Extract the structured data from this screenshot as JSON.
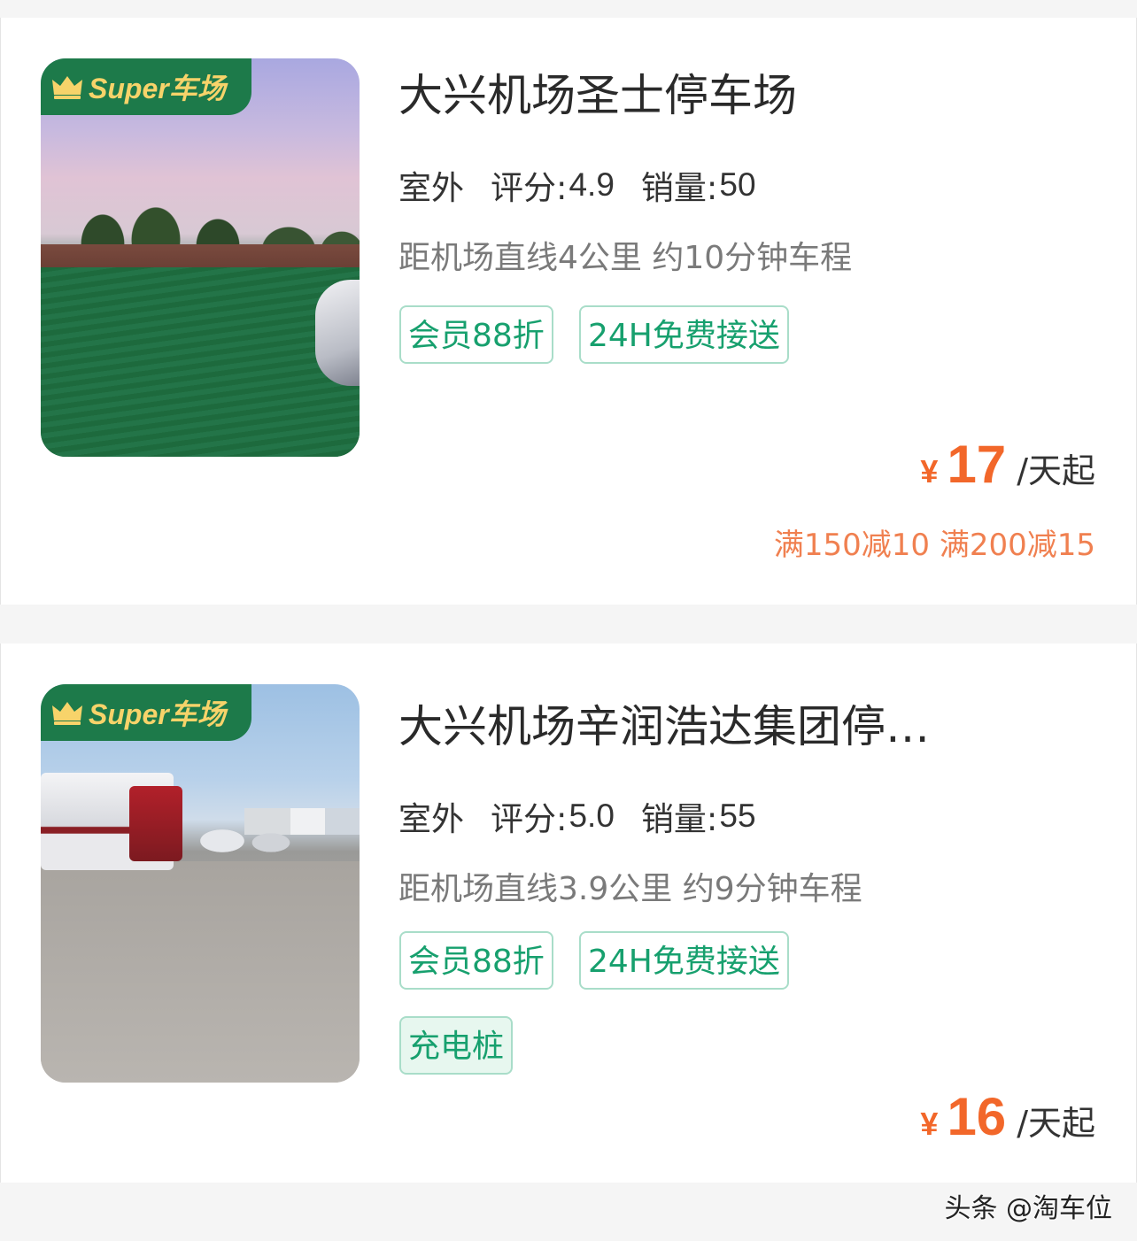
{
  "listings": [
    {
      "badge": "Super车场",
      "name": "大兴机场圣士停车场",
      "type": "室外",
      "rating_label": "评分:",
      "rating": "4.9",
      "sales_label": "销量:",
      "sales": "50",
      "distance": "距机场直线4公里 约10分钟车程",
      "tags": [
        "会员88折",
        "24H免费接送"
      ],
      "currency": "¥",
      "price": "17",
      "unit": "/天起",
      "discount": "满150减10 满200减15"
    },
    {
      "badge": "Super车场",
      "name": "大兴机场辛润浩达集团停…",
      "type": "室外",
      "rating_label": "评分:",
      "rating": "5.0",
      "sales_label": "销量:",
      "sales": "55",
      "distance": "距机场直线3.9公里 约9分钟车程",
      "tags": [
        "会员88折",
        "24H免费接送",
        "充电桩"
      ],
      "currency": "¥",
      "price": "16",
      "unit": "/天起"
    }
  ],
  "watermark": "头条 @淘车位",
  "colors": {
    "accent_green": "#17a06e",
    "badge_green": "#1d7a4a",
    "badge_gold": "#f7d36a",
    "price_orange": "#f2672a"
  },
  "icons": {
    "badge_icon": "crown-icon"
  }
}
